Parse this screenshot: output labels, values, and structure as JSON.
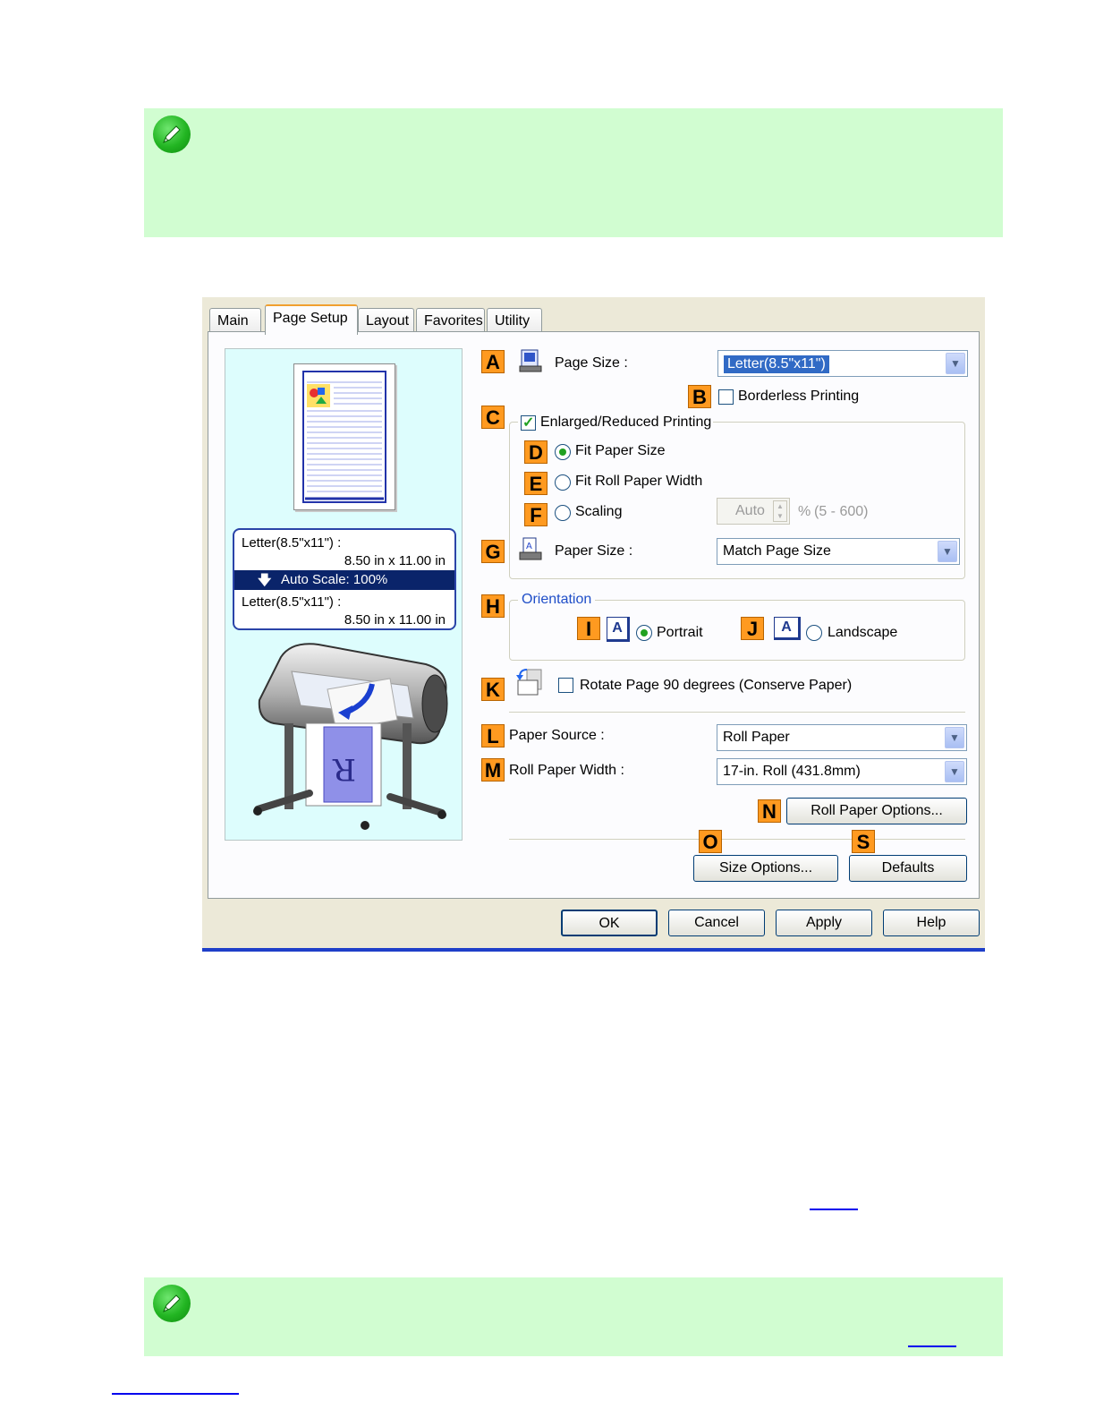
{
  "dialog": {
    "tabs": [
      "Main",
      "Page Setup",
      "Layout",
      "Favorites",
      "Utility"
    ],
    "active_tab": "Page Setup",
    "preview": {
      "info_line1": "Letter(8.5\"x11\") :",
      "info_line2": "8.50 in x 11.00 in",
      "scale_line": "Auto Scale: 100%",
      "info_line3": "Letter(8.5\"x11\") :",
      "info_line4": "8.50 in x 11.00 in"
    },
    "letters": {
      "A": "A",
      "B": "B",
      "C": "C",
      "D": "D",
      "E": "E",
      "F": "F",
      "G": "G",
      "H": "H",
      "I": "I",
      "J": "J",
      "K": "K",
      "L": "L",
      "M": "M",
      "N": "N",
      "O": "O",
      "S": "S"
    },
    "page_size": {
      "label": "Page Size :",
      "value": "Letter(8.5\"x11\")"
    },
    "borderless": {
      "label": "Borderless Printing",
      "checked": false
    },
    "enlarged": {
      "label": "Enlarged/Reduced Printing",
      "checked": true
    },
    "fit_paper": {
      "label": "Fit Paper Size",
      "selected": true
    },
    "fit_roll": {
      "label": "Fit Roll Paper Width",
      "selected": false
    },
    "scaling": {
      "label": "Scaling",
      "value": "Auto",
      "unit": "%",
      "range": "(5 - 600)"
    },
    "paper_size": {
      "label": "Paper Size :",
      "value": "Match Page Size"
    },
    "orientation": {
      "title": "Orientation",
      "portrait": "Portrait",
      "landscape": "Landscape",
      "icon_glyph": "A",
      "selected": "Portrait"
    },
    "rotate": {
      "label": "Rotate Page 90 degrees (Conserve Paper)",
      "checked": false
    },
    "paper_source": {
      "label": "Paper Source :",
      "value": "Roll Paper"
    },
    "roll_width": {
      "label": "Roll Paper Width :",
      "value": "17-in. Roll (431.8mm)"
    },
    "buttons": {
      "roll_options": "Roll Paper Options...",
      "size_options": "Size Options...",
      "defaults": "Defaults",
      "ok": "OK",
      "cancel": "Cancel",
      "apply": "Apply",
      "help": "Help"
    }
  },
  "colors": {
    "note_background": "#d1fdd1",
    "letter_tag": "#ff9a20",
    "selection": "#316ac5",
    "link": "#0000ee"
  }
}
